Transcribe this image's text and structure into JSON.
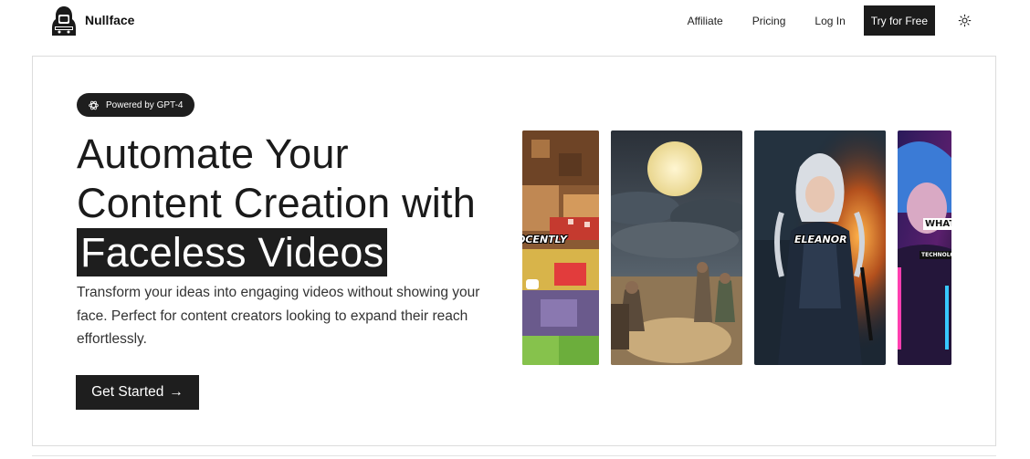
{
  "brand": {
    "name": "Nullface",
    "logo_icon": "hooded-figure-logo-icon"
  },
  "nav": {
    "links": [
      "Affiliate",
      "Pricing",
      "Log In"
    ],
    "cta": "Try for Free",
    "theme_icon": "sun-icon"
  },
  "hero": {
    "badge": "Powered by GPT-4",
    "badge_icon": "openai-icon",
    "headline_line1": "Automate Your",
    "headline_line2": "Content Creation with",
    "headline_highlight": "Faceless Videos",
    "subtext": "Transform your ideas into engaging videos without showing your face. Perfect for content creators looking to expand their reach effortlessly.",
    "cta": "Get Started",
    "cta_arrow": "→"
  },
  "videos": [
    {
      "caption": "OCENTLY",
      "scene": "minecraft"
    },
    {
      "caption": "",
      "scene": "moonlit-gathering"
    },
    {
      "caption": "ELEANOR",
      "scene": "white-haired-warrior"
    },
    {
      "caption": "WHAT H",
      "subcaption": "TECHNOLOGY",
      "scene": "neon-cyber-woman"
    }
  ],
  "colors": {
    "accent": "#1e1e1e",
    "border": "#dcdcdc"
  }
}
